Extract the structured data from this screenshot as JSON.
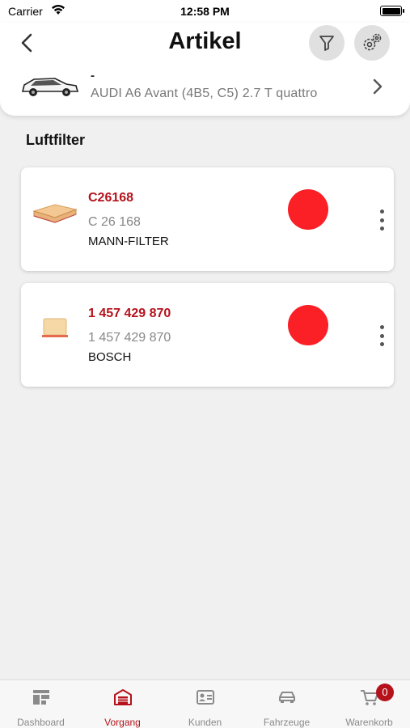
{
  "status_bar": {
    "carrier": "Carrier",
    "time": "12:58 PM"
  },
  "header": {
    "title": "Artikel"
  },
  "vehicle": {
    "dash": "-",
    "name": "AUDI A6 Avant (4B5, C5) 2.7 T quattro"
  },
  "section": {
    "title": "Luftfilter"
  },
  "articles": [
    {
      "number": "C26168",
      "sub": "C 26 168",
      "brand": "MANN-FILTER",
      "status_color": "#fb1f26"
    },
    {
      "number": "1 457 429 870",
      "sub": "1 457 429 870",
      "brand": "BOSCH",
      "status_color": "#fb1f26"
    }
  ],
  "tabs": [
    {
      "label": "Dashboard",
      "icon": "dashboard-icon",
      "active": false
    },
    {
      "label": "Vorgang",
      "icon": "garage-icon",
      "active": true
    },
    {
      "label": "Kunden",
      "icon": "contact-card-icon",
      "active": false
    },
    {
      "label": "Fahrzeuge",
      "icon": "car-icon",
      "active": false
    },
    {
      "label": "Warenkorb",
      "icon": "cart-icon",
      "active": false
    }
  ],
  "cart": {
    "badge_count": "0"
  },
  "colors": {
    "accent": "#b5121b",
    "status_red": "#fb1f26",
    "background": "#f0f0f0"
  }
}
